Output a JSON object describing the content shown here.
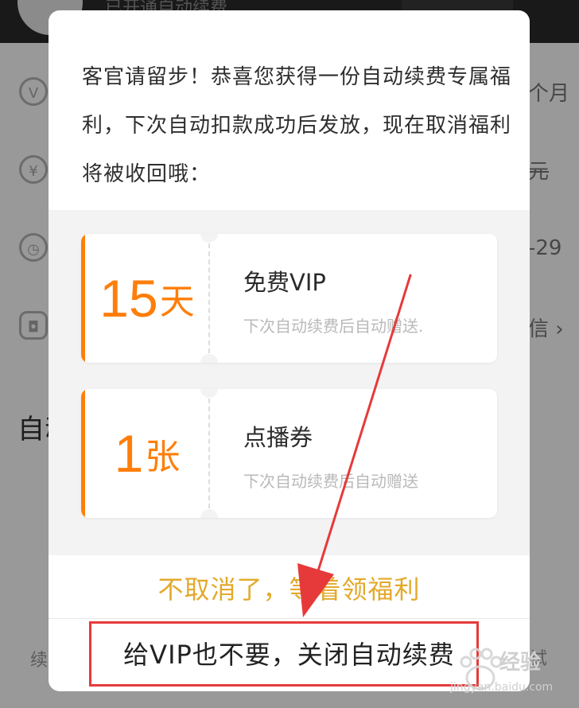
{
  "background": {
    "top_text": "已开通自动续费",
    "row_right_1": "个月",
    "row_right_2": "元",
    "row_right_3": "-29",
    "row_right_4": "信 ›",
    "heading": "自动",
    "footer_left": "续",
    "footer_right": "试",
    "icons": [
      "vip-icon",
      "yuan-icon",
      "clock-icon",
      "card-icon"
    ],
    "icon_glyphs": [
      "V",
      "¥",
      "◷",
      "◘"
    ]
  },
  "dialog": {
    "message": "客官请留步！恭喜您获得一份自动续费专属福利，下次自动扣款成功后发放，现在取消福利将被收回哦：",
    "coupons": [
      {
        "amount": "15",
        "unit": "天",
        "title": "免费VIP",
        "desc": "下次自动续费后自动赠送."
      },
      {
        "amount": "1",
        "unit": "张",
        "title": "点播券",
        "desc": "下次自动续费后自动赠送"
      }
    ],
    "keep_label": "不取消了，等着领福利",
    "cancel_label": "给VIP也不要，关闭自动续费"
  },
  "watermark": {
    "text": "经验",
    "url": "jingyan.baidu.com"
  },
  "colors": {
    "accent": "#ff7e0a",
    "keep_button": "#e3a92a",
    "annotation": "#e63a3a",
    "overlay": "rgba(0,0,0,0.4)"
  }
}
